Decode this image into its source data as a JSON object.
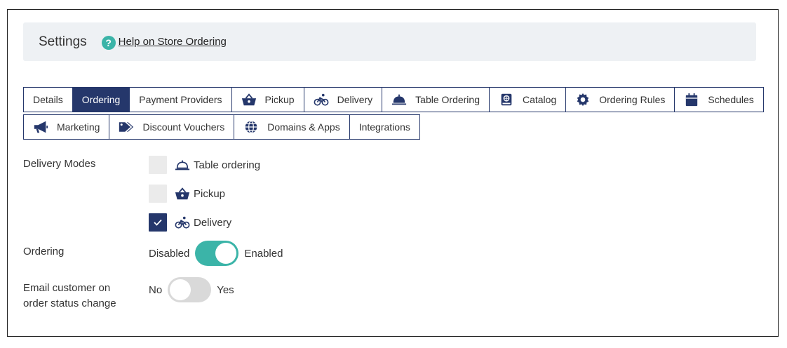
{
  "header": {
    "title": "Settings",
    "help_icon_glyph": "?",
    "help_link": "Help on Store Ordering"
  },
  "tabs_row1": [
    {
      "label": "Details",
      "icon": null,
      "active": false
    },
    {
      "label": "Ordering",
      "icon": null,
      "active": true
    },
    {
      "label": "Payment Providers",
      "icon": null,
      "active": false
    },
    {
      "label": "Pickup",
      "icon": "basket-icon",
      "active": false
    },
    {
      "label": "Delivery",
      "icon": "bicycle-icon",
      "active": false
    },
    {
      "label": "Table Ordering",
      "icon": "cloche-icon",
      "active": false
    },
    {
      "label": "Catalog",
      "icon": "book-icon",
      "active": false
    },
    {
      "label": "Ordering Rules",
      "icon": "gear-icon",
      "active": false
    },
    {
      "label": "Schedules",
      "icon": "calendar-icon",
      "active": false
    }
  ],
  "tabs_row2": [
    {
      "label": "Marketing",
      "icon": "megaphone-icon",
      "active": false
    },
    {
      "label": "Discount Vouchers",
      "icon": "tags-icon",
      "active": false
    },
    {
      "label": "Domains & Apps",
      "icon": "globe-icon",
      "active": false
    },
    {
      "label": "Integrations",
      "icon": null,
      "active": false
    }
  ],
  "delivery_modes": {
    "label": "Delivery Modes",
    "options": [
      {
        "label": "Table ordering",
        "icon": "cloche-icon",
        "checked": false
      },
      {
        "label": "Pickup",
        "icon": "basket-icon",
        "checked": false
      },
      {
        "label": "Delivery",
        "icon": "bicycle-icon",
        "checked": true
      }
    ]
  },
  "ordering": {
    "label": "Ordering",
    "off_label": "Disabled",
    "on_label": "Enabled",
    "enabled": true
  },
  "email_customer": {
    "label_line1": "Email customer on",
    "label_line2": "order status change",
    "off_label": "No",
    "on_label": "Yes",
    "enabled": false
  },
  "colors": {
    "navy": "#25376b",
    "teal": "#3bb4a8",
    "header_bg": "#eef1f4",
    "checkbox_bg": "#ebebeb",
    "switch_off": "#d9d9d9"
  }
}
